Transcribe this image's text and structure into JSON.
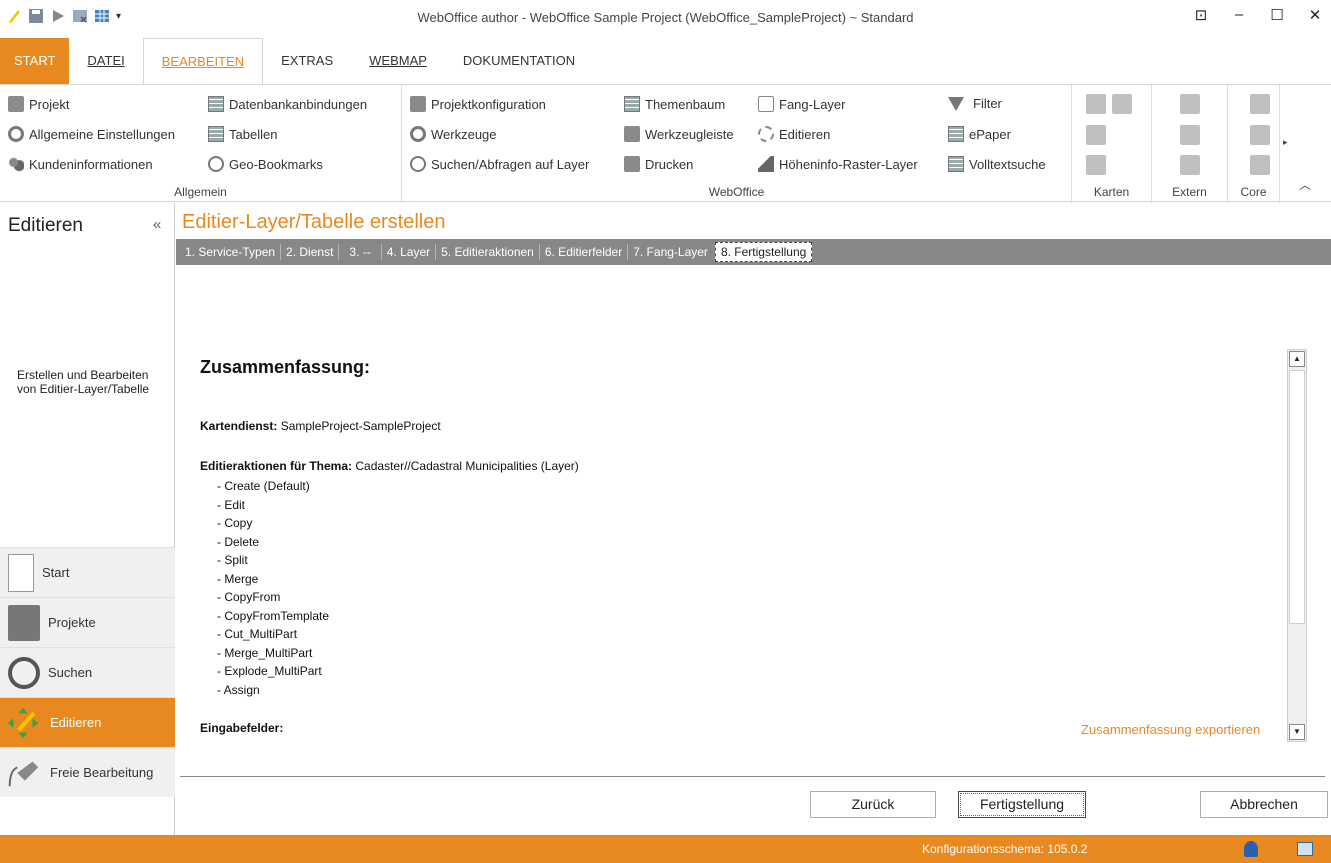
{
  "window": {
    "title": "WebOffice author - WebOffice Sample Project (WebOffice_SampleProject) ~ Standard"
  },
  "ribbon_tabs": [
    {
      "label": "START"
    },
    {
      "label": "DATEI"
    },
    {
      "label": "BEARBEITEN"
    },
    {
      "label": "EXTRAS"
    },
    {
      "label": "WEBMAP"
    },
    {
      "label": "DOKUMENTATION"
    }
  ],
  "ribbon": {
    "allgemein": {
      "label": "Allgemein",
      "items": [
        "Projekt",
        "Allgemeine Einstellungen",
        "Kundeninformationen",
        "Datenbankanbindungen",
        "Tabellen",
        "Geo-Bookmarks"
      ]
    },
    "weboffice": {
      "label": "WebOffice",
      "items": [
        "Projektkonfiguration",
        "Werkzeuge",
        "Suchen/Abfragen auf Layer",
        "Themenbaum",
        "Werkzeugleiste",
        "Drucken",
        "Fang-Layer",
        "Editieren",
        "Höheninfo-Raster-Layer",
        "Filter",
        "ePaper",
        "Volltextsuche"
      ]
    },
    "karten": {
      "label": "Karten"
    },
    "extern": {
      "label": "Extern"
    },
    "core": {
      "label": "Core"
    }
  },
  "left_panel": {
    "title": "Editieren",
    "collapse": "«",
    "description": "Erstellen und Bearbeiten von Editier-Layer/Tabelle",
    "nav": [
      {
        "label": "Start"
      },
      {
        "label": "Projekte"
      },
      {
        "label": "Suchen"
      },
      {
        "label": "Editieren"
      },
      {
        "label": "Freie Bearbeitung"
      }
    ]
  },
  "main": {
    "title": "Editier-Layer/Tabelle erstellen",
    "steps": [
      "1. Service-Typen",
      "2. Dienst",
      "3. --",
      "4. Layer",
      "5. Editieraktionen",
      "6. Editierfelder",
      "7. Fang-Layer",
      "8. Fertigstellung"
    ],
    "summary": {
      "heading": "Zusammenfassung:",
      "kartendienst_label": "Kartendienst:",
      "kartendienst_value": "SampleProject-SampleProject",
      "editieraktionen_label": "Editieraktionen für Thema:",
      "editieraktionen_value": "Cadaster//Cadastral Municipalities (Layer)",
      "actions": [
        "- Create (Default)",
        "- Edit",
        "- Copy",
        "- Delete",
        "- Split",
        "- Merge",
        "- CopyFrom",
        "- CopyFromTemplate",
        "- Cut_MultiPart",
        "- Merge_MultiPart",
        "- Explode_MultiPart",
        "- Assign"
      ],
      "eingabefelder_label": "Eingabefelder:"
    },
    "export_link": "Zusammenfassung exportieren",
    "buttons": {
      "back": "Zurück",
      "finish": "Fertigstellung",
      "cancel": "Abbrechen"
    }
  },
  "status_bar": {
    "text": "Konfigurationsschema:  105.0.2"
  },
  "colors": {
    "accent": "#e8891f",
    "step_bar": "#888888"
  }
}
